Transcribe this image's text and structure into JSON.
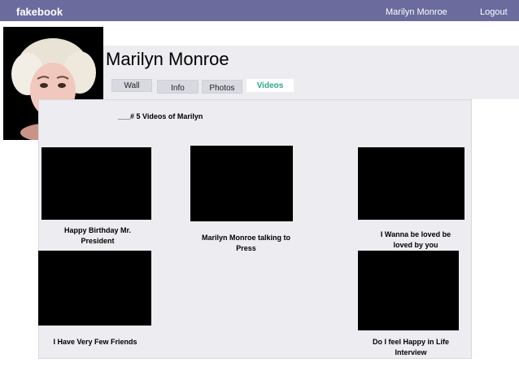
{
  "nav": {
    "brand": "fakebook",
    "user": "Marilyn Monroe",
    "logout": "Logout"
  },
  "profile": {
    "name": "Marilyn Monroe"
  },
  "tabs": [
    {
      "label": "Wall",
      "active": false
    },
    {
      "label": "Info",
      "active": false
    },
    {
      "label": "Photos",
      "active": false
    },
    {
      "label": "Videos",
      "active": true
    }
  ],
  "videos": {
    "section_title": "___# 5 Videos of Marilyn",
    "items": [
      {
        "caption": "Happy Birthday Mr. President"
      },
      {
        "caption": "Marilyn Monroe talking to Press"
      },
      {
        "caption": "I Wanna be loved be loved by you"
      },
      {
        "caption": "I Have Very Few Friends"
      },
      {
        "caption": "Do I feel Happy in Life Interview"
      }
    ]
  },
  "colors": {
    "topbar": "#6b6b9e",
    "active_tab_text": "#2aa88e",
    "panel": "#ececf1"
  }
}
